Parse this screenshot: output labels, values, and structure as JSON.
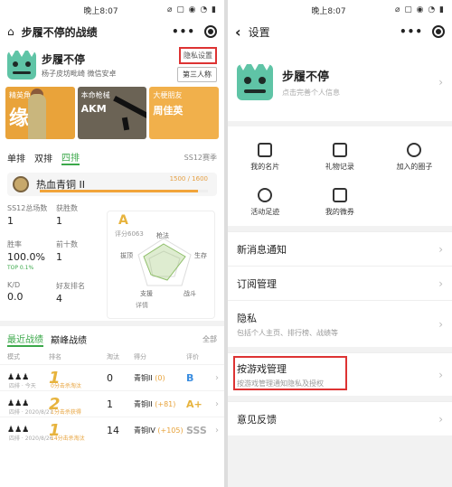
{
  "left": {
    "status": {
      "time": "晚上8:07",
      "icons": "⌀ ▢ ◉ ◔ ▮"
    },
    "nav": {
      "title": "步履不停的战绩",
      "more": "•••"
    },
    "profile": {
      "name": "步履不停",
      "sub": "杨子皮坊毗崎 微信安卓",
      "privacy": "隐私设置",
      "viewer": "第三人称"
    },
    "cards": [
      {
        "label": "精英角色",
        "big": "缘",
        "val": ""
      },
      {
        "label": "本命枪械",
        "big": "",
        "val": "AKM"
      },
      {
        "label": "大梗朋友",
        "big": "",
        "val": "周佳英"
      }
    ],
    "modes": {
      "solo": "单排",
      "duo": "双排",
      "squad": "四排",
      "season": "SS12赛季"
    },
    "rank": {
      "name": "热血青铜 II",
      "points": "1500 / 1600",
      "progress": 0.94
    },
    "stats": [
      {
        "label": "SS12总场数",
        "value": "1"
      },
      {
        "label": "获胜数",
        "value": "1"
      },
      {
        "label": "胜率",
        "value": "100.0%"
      },
      {
        "label": "前十数",
        "value": "1"
      },
      {
        "label": "K/D",
        "value": "0.0"
      },
      {
        "label": "好友排名",
        "value": "4"
      }
    ],
    "win_top": "TOP 0.1%",
    "radar": {
      "grade": "A",
      "score": "评分6063",
      "labels": [
        "枪法",
        "生存",
        "战斗",
        "支援",
        "拔顶"
      ],
      "detail": "详情"
    },
    "battle": {
      "tab_recent": "最近战绩",
      "tab_peak": "巅峰战绩",
      "all": "全部"
    },
    "thead": [
      "模式",
      "排名",
      "淘汰",
      "得分",
      "评价"
    ],
    "rows": [
      {
        "rank": "1",
        "kills": "0",
        "tier": "青铜II",
        "delta": "(0)",
        "grade": "B",
        "gc": "#3a8de0",
        "note": "四排 · 今天",
        "note2": "0分击杀淘汰"
      },
      {
        "rank": "2",
        "kills": "1",
        "tier": "青铜II",
        "delta": "(+81)",
        "grade": "A+",
        "gc": "#e7b33d",
        "note": "四排 · 2020/8/27",
        "note2": "1分击杀获得"
      },
      {
        "rank": "1",
        "kills": "14",
        "tier": "青铜IV",
        "delta": "(+105)",
        "grade": "SSS",
        "gc": "#aaaaaa",
        "note": "四排 · 2020/8/26",
        "note2": "14分击杀淘汰"
      }
    ]
  },
  "right": {
    "status": {
      "time": "晚上8:07",
      "icons": "⌀ ▢ ◉ ◔ ▮"
    },
    "nav": {
      "title": "设置",
      "back": "‹",
      "more": "•••"
    },
    "profile": {
      "name": "步履不停",
      "sub": "点击完善个人信息"
    },
    "grid": [
      {
        "label": "我的名片",
        "icon": "card-icon"
      },
      {
        "label": "礼物记录",
        "icon": "gift-icon"
      },
      {
        "label": "加入的圈子",
        "icon": "chat-icon"
      },
      {
        "label": "活动足迹",
        "icon": "clock-icon"
      },
      {
        "label": "我的微券",
        "icon": "ticket-icon"
      }
    ],
    "menu": [
      {
        "label": "新消息通知",
        "sub": ""
      },
      {
        "label": "订阅管理",
        "sub": ""
      },
      {
        "label": "隐私",
        "sub": "包括个人主页、排行榜、战绩等"
      },
      {
        "label": "按游戏管理",
        "sub": "按游戏管理通知隐私及授权"
      },
      {
        "label": "意见反馈",
        "sub": ""
      }
    ]
  }
}
